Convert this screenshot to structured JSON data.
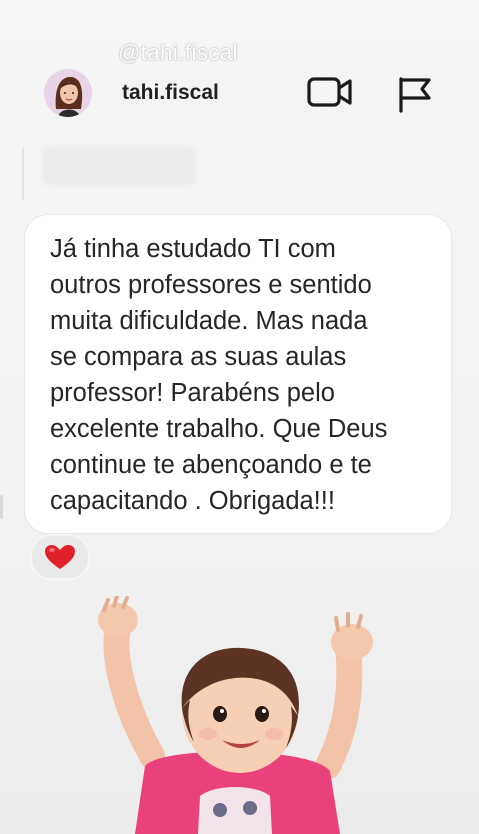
{
  "watermark": "@tahi.fiscal",
  "header": {
    "username": "tahi.fiscal",
    "video_icon": "video-camera-icon",
    "flag_icon": "flag-icon"
  },
  "message": {
    "text": "Já tinha estudado TI com\noutros professores e sentido\nmuita dificuldade. Mas nada\nse compara as suas aulas\nprofessor! Parabéns pelo\nexcelente trabalho. Que Deus\ncontinue te abençoando e te\ncapacitando . Obrigada!!!",
    "reaction": "❤️"
  },
  "sticker": {
    "icon": "celebrating-baby-sticker"
  },
  "colors": {
    "text": "#262626",
    "reaction_heart": "#e0202b",
    "shirt": "#e9417c"
  }
}
